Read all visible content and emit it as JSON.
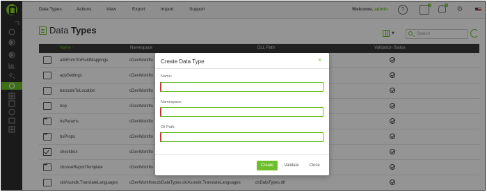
{
  "topbar": {
    "menu": [
      "Data Types",
      "Actions",
      "View",
      "Export",
      "Import",
      "Support"
    ],
    "welcome_prefix": "Welcome,",
    "username": "admin",
    "help_glyph": "?",
    "notifications_badge": "0",
    "alerts_badge": "0",
    "icons": [
      "app-logo-icon",
      "help-icon",
      "chat-icon",
      "bell-icon",
      "settings-icon",
      "us-flag-icon"
    ]
  },
  "sidebar": {
    "icons": [
      "collapse-icon",
      "home-icon",
      "dashboard-icon",
      "play-icon",
      "play-filled-icon",
      "report-icon",
      "link-icon",
      "data-types-icon",
      "grid-icon",
      "help-circle-icon",
      "folder-icon",
      "apps-icon"
    ],
    "active_index": 7
  },
  "main": {
    "title_light": "Data",
    "title_bold": "Types",
    "search_placeholder": "Search",
    "table": {
      "columns": [
        "Name",
        "Namespace",
        "DLL Path",
        "Validation Status"
      ],
      "sort_glyph": "↑",
      "rows": [
        {
          "icon": "folder",
          "name": "addFormToFieldMappings",
          "namespace": "cDevWorkflo",
          "dll": ""
        },
        {
          "icon": "folder",
          "name": "appSettings",
          "namespace": "cDevWorkflo",
          "dll": ""
        },
        {
          "icon": "folder",
          "name": "barcodeToLocation",
          "namespace": "cDevWorkflo",
          "dll": ""
        },
        {
          "icon": "folder",
          "name": "bop",
          "namespace": "cDevWorkflo",
          "dll": ""
        },
        {
          "icon": "dots",
          "name": "bsParams",
          "namespace": "cDevWorkflo",
          "dll": ""
        },
        {
          "icon": "dots",
          "name": "bsProps",
          "namespace": "cDevWorkflo",
          "dll": ""
        },
        {
          "icon": "check",
          "name": "checkbox",
          "namespace": "cDevWorkflo",
          "dll": ""
        },
        {
          "icon": "dots",
          "name": "chooseReportTemplate",
          "namespace": "cDevWorkflo",
          "dll": ""
        },
        {
          "icon": "folder",
          "name": "ckiAsundk.TranslateLanguages",
          "namespace": "cDevWorkflow.dsDataTypes.ckiAsundk.TranslateLanguages",
          "dll": "dsDataTypes.dll"
        }
      ]
    }
  },
  "modal": {
    "title": "Create Data Type",
    "close_glyph": "×",
    "fields": [
      {
        "label": "Name:",
        "value": ""
      },
      {
        "label": "Namespace:",
        "value": ""
      },
      {
        "label": "Dll Path:",
        "value": ""
      }
    ],
    "buttons": {
      "create": "Create",
      "validate": "Validate",
      "close": "Close"
    }
  },
  "colors": {
    "accent": "#6cbf2a",
    "required": "#c0392b",
    "sidebar": "#2d2d2d",
    "header": "#3a3a3a"
  }
}
